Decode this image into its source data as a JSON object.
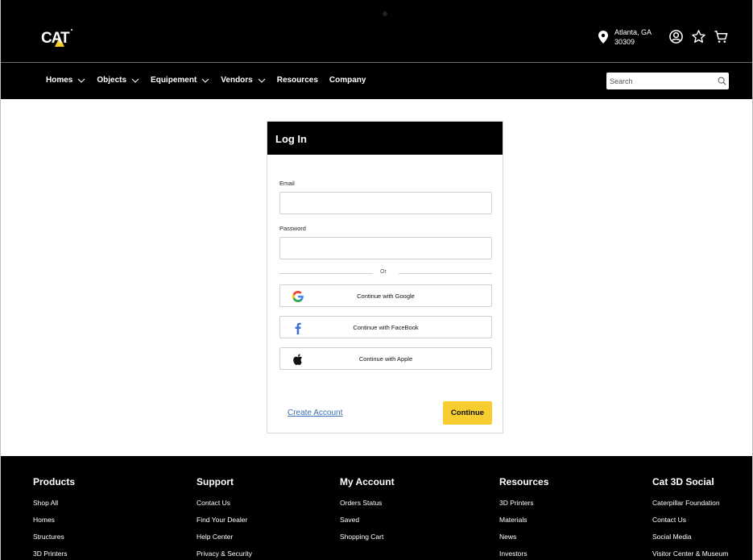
{
  "header": {
    "logo_text": "CAT",
    "location": {
      "city": "Atlanta, GA",
      "zip": "30309"
    },
    "icons": [
      "location-pin-icon",
      "account-icon",
      "favorites-star-icon",
      "cart-icon"
    ]
  },
  "nav": {
    "items": [
      {
        "label": "Homes",
        "dropdown": true
      },
      {
        "label": "Objects",
        "dropdown": true
      },
      {
        "label": "Equipement",
        "dropdown": true
      },
      {
        "label": "Vendors",
        "dropdown": true
      },
      {
        "label": "Resources",
        "dropdown": false
      },
      {
        "label": "Company",
        "dropdown": false
      }
    ],
    "search_placeholder": "Search"
  },
  "login": {
    "title": "Log In",
    "email_label": "Email",
    "email_value": "",
    "password_label": "Password",
    "password_value": "",
    "or_label": "Or",
    "google_label": "Continue with Google",
    "facebook_label": "Continue with FaceBook",
    "apple_label": "Continue with Apple",
    "create_account": "Create Account",
    "continue_label": "Continue"
  },
  "footer": {
    "columns": [
      {
        "title": "Products",
        "links": [
          "Shop All",
          "Homes",
          "Structures",
          "3D Printers"
        ]
      },
      {
        "title": "Support",
        "links": [
          "Contact Us",
          "Find Your Dealer",
          "Help Center",
          "Privacy & Security"
        ]
      },
      {
        "title": "My Account",
        "links": [
          "Orders Status",
          "Saved",
          "Shopping Cart"
        ]
      },
      {
        "title": "Resources",
        "links": [
          "3D Printers",
          "Materials",
          "News",
          "Investors"
        ]
      },
      {
        "title": "Cat 3D Social",
        "links": [
          "Caterpillar Foundation",
          "Contact Us",
          "Social Media",
          "Visitor Center & Museum"
        ]
      }
    ]
  },
  "colors": {
    "accent_yellow": "#F7CD2F",
    "header_bg": "#000000",
    "link_blue": "#3A6FB5"
  }
}
